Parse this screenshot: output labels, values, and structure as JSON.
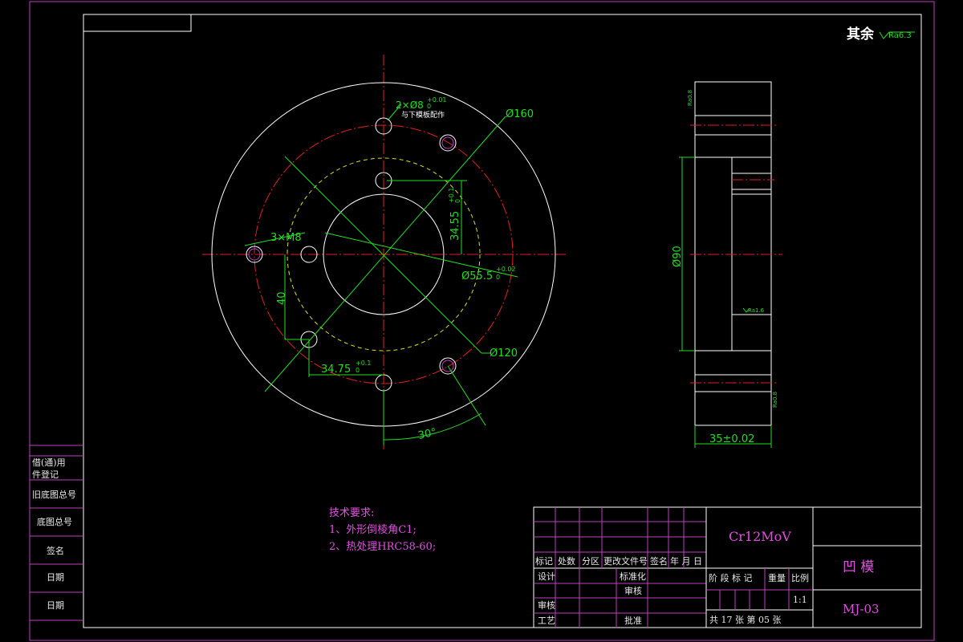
{
  "roughness": {
    "label": "其余",
    "value": "Ra6.3"
  },
  "front_view": {
    "dim_holes_pin": "2×Ø8",
    "dim_holes_pin_tol": "+0.01",
    "dim_holes_pin_tol_low": "0",
    "pin_note": "与下模板配作",
    "dim_outer": "Ø160",
    "dim_bolt_circle": "Ø120",
    "dim_bore": "Ø55.5",
    "dim_bore_tol": "+0.02",
    "dim_bore_tol_low": "0",
    "dim_thread": "3×M8",
    "dim_vertical_offset": "34.55",
    "dim_vertical_offset_tol": "+0.1",
    "dim_vertical_offset_tol_low": "0",
    "dim_horizontal_offset": "34.75",
    "dim_horizontal_offset_tol": "+0.1",
    "dim_horizontal_offset_tol_low": "0",
    "dim_forty": "40",
    "dim_angle": "30°"
  },
  "side_view": {
    "dim_diameter": "Ø90",
    "dim_thickness": "35±0.02",
    "ra_top": "Ra0.8",
    "ra_mid": "Ra1.6",
    "ra_bottom": "Ra0.8"
  },
  "tech_requirements": {
    "title": "技术要求:",
    "items": [
      "1、外形倒棱角C1;",
      "2、热处理HRC58-60;"
    ]
  },
  "left_column": [
    "借(通)用",
    "件登记",
    "旧底图总号",
    "底图总号",
    "签名",
    "日期",
    "日期"
  ],
  "title_block": {
    "material": "Cr12MoV",
    "part_name": "凹 模",
    "drawing_no": "MJ-03",
    "rev_headers": [
      "标记",
      "处数",
      "分区",
      "更改文件号",
      "签名",
      "年 月 日"
    ],
    "design": "设计",
    "standardization": "标准化",
    "review": "审核",
    "process": "工艺",
    "approve": "批准",
    "check": "审核",
    "stage_headers": [
      "阶 段 标 记",
      "重量",
      "比例"
    ],
    "scale": "1:1",
    "sheets": "共 17 张   第 05 张"
  }
}
